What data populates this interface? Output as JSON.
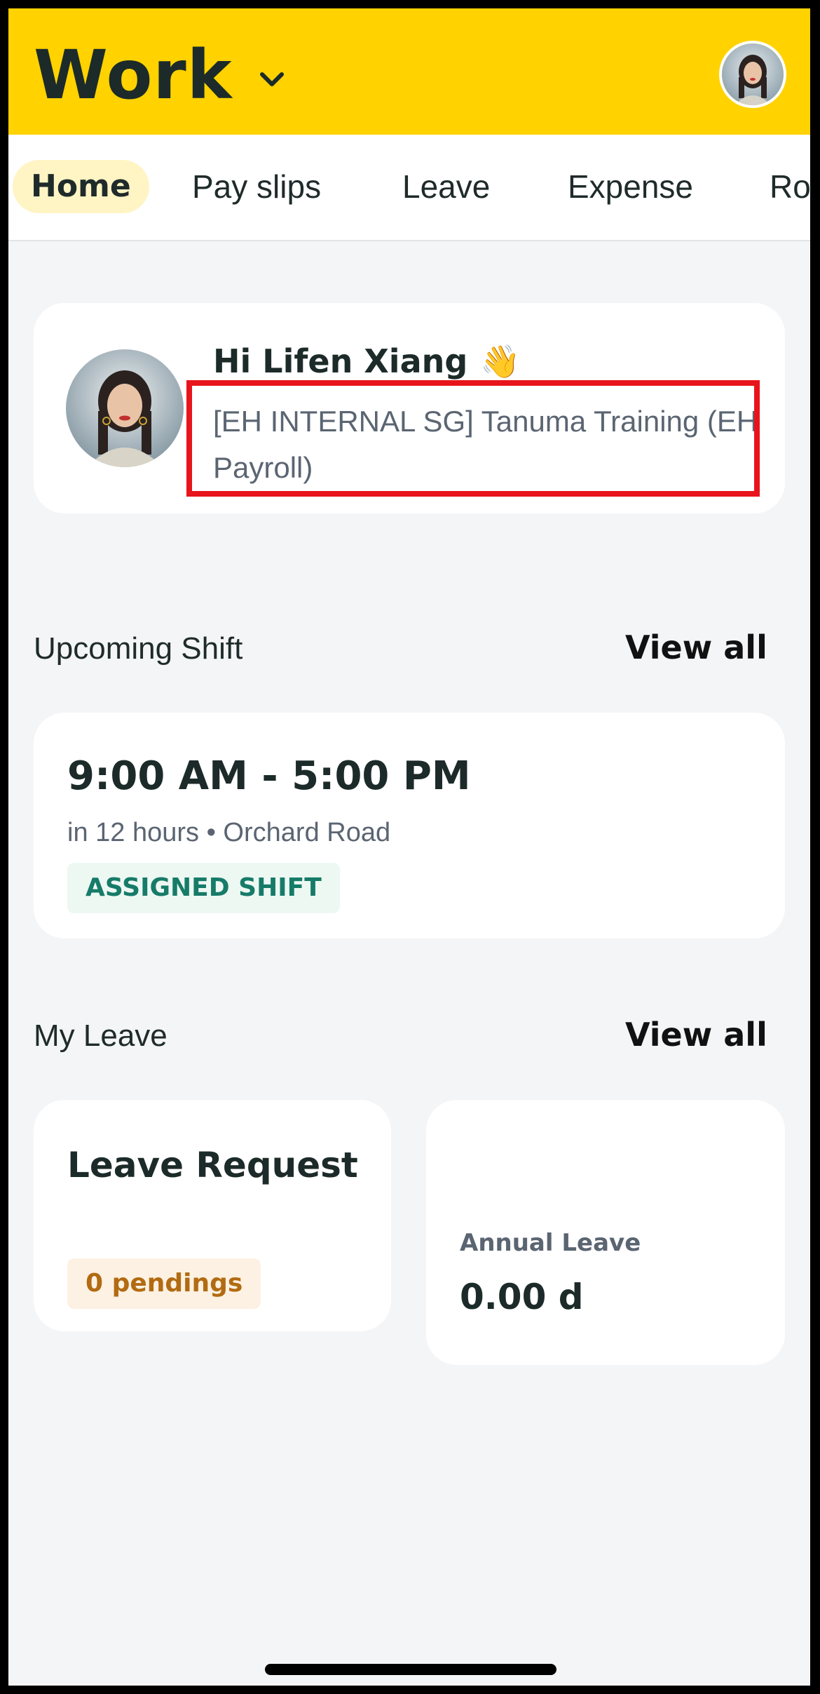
{
  "header": {
    "title": "Work",
    "chevron_icon": "chevron-down-icon",
    "avatar_icon": "profile-avatar"
  },
  "tabs": [
    {
      "label": "Home",
      "active": true
    },
    {
      "label": "Pay slips",
      "active": false
    },
    {
      "label": "Leave",
      "active": false
    },
    {
      "label": "Expense",
      "active": false
    },
    {
      "label": "Ro",
      "active": false
    }
  ],
  "greeting": {
    "name": "Hi Lifen Xiang",
    "emoji": "👋",
    "org": "[EH INTERNAL SG] Tanuma Training (EH Payroll)"
  },
  "highlight_color": "#e8141b",
  "upcoming_shift": {
    "title": "Upcoming Shift",
    "view_all": "View all",
    "time": "9:00 AM - 5:00 PM",
    "meta": "in 12 hours • Orchard Road",
    "badge": "ASSIGNED SHIFT"
  },
  "my_leave": {
    "title": "My Leave",
    "view_all": "View all",
    "request_title": "Leave Request",
    "pending": "0 pendings",
    "annual_label": "Annual Leave",
    "annual_value": "0.00 d"
  },
  "colors": {
    "header_bg": "#ffd200",
    "active_tab_bg": "#fff4c4",
    "badge_green": "#167b68",
    "badge_orange": "#b26b12"
  }
}
